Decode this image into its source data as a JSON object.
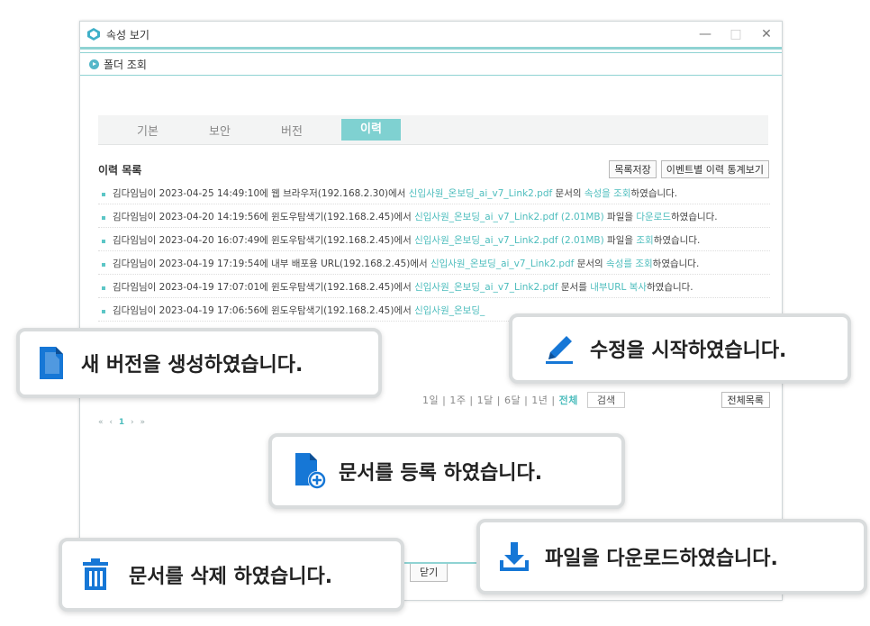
{
  "window": {
    "title": "속성 보기",
    "controls": [
      "—",
      "□",
      "✕"
    ]
  },
  "section": {
    "label": "폴더 조회"
  },
  "tabs": [
    {
      "label": "기본",
      "active": false
    },
    {
      "label": "보안",
      "active": false
    },
    {
      "label": "버전",
      "active": false
    },
    {
      "label": "이력",
      "active": true
    }
  ],
  "list": {
    "title": "이력 목록",
    "save_label": "목록저장",
    "stats_label": "이벤트별 이력 통계보기"
  },
  "rows": [
    {
      "pre": "김다임님이 2023-04-25 14:49:10에 웹 브라우저(192.168.2.30)에서 ",
      "file": "신입사원_온보딩_ai_v7_Link2.pdf",
      "mid": " 문서의 ",
      "act": "속성을 조회",
      "post": "하였습니다."
    },
    {
      "pre": "김다임님이 2023-04-20 14:19:56에 윈도우탐색기(192.168.2.45)에서 ",
      "file": "신입사원_온보딩_ai_v7_Link2.pdf (2.01MB)",
      "mid": " 파일을 ",
      "act": "다운로드",
      "post": "하였습니다."
    },
    {
      "pre": "김다임님이 2023-04-20 16:07:49에 윈도우탐색기(192.168.2.45)에서 ",
      "file": "신입사원_온보딩_ai_v7_Link2.pdf (2.01MB)",
      "mid": " 파일을 ",
      "act": "조회",
      "post": "하였습니다."
    },
    {
      "pre": "김다임님이 2023-04-19 17:19:54에 내부 배포용 URL(192.168.2.45)에서 ",
      "file": "신입사원_온보딩_ai_v7_Link2.pdf",
      "mid": " 문서의 ",
      "act": "속성를 조회",
      "post": "하였습니다."
    },
    {
      "pre": "김다임님이 2023-04-19 17:07:01에 윈도우탐색기(192.168.2.45)에서 ",
      "file": "신입사원_온보딩_ai_v7_Link2.pdf",
      "mid": " 문서를 ",
      "act": "내부URL 복사",
      "post": "하였습니다."
    },
    {
      "pre": "김다임님이 2023-04-19 17:06:56에 윈도우탐색기(192.168.2.45)에서 ",
      "file": "신입사원_온보딩_",
      "mid": "",
      "act": "",
      "post": ""
    }
  ],
  "search": {
    "period": "1일 | 1주 | 1달 | 6달 | 1년 | ",
    "period_all": "전체",
    "search_label": "검색",
    "list_all_label": "전체목록"
  },
  "pager": {
    "first": "«",
    "prev": "‹",
    "page": "1",
    "next": "›",
    "last": "»"
  },
  "footer": {
    "close_label": "닫기"
  },
  "toasts": {
    "new_version": "새 버전을 생성하였습니다.",
    "edit_start": "수정을 시작하였습니다.",
    "register": "문서를 등록 하였습니다.",
    "delete": "문서를 삭제 하였습니다.",
    "download": "파일을 다운로드하였습니다."
  },
  "colors": {
    "accent": "#4dbdbd",
    "tab_active": "#7fd1d1",
    "icon_blue": "#1677d6"
  }
}
